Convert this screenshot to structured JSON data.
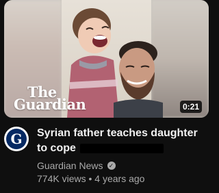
{
  "video": {
    "thumbnail_logo_line1": "The",
    "thumbnail_logo_line2": "Guardian",
    "duration": "0:21",
    "title_line1": "Syrian father teaches daughter",
    "title_line2": "to cope",
    "channel_name": "Guardian News",
    "channel_avatar_letter": "G",
    "views": "774K views",
    "separator": "•",
    "age": "4 years ago",
    "verified_icon": "checkmark-icon"
  },
  "colors": {
    "background": "#0f0f0f",
    "title": "#f1f1f1",
    "secondary_text": "#aaaaaa",
    "avatar_brand": "#052962"
  }
}
